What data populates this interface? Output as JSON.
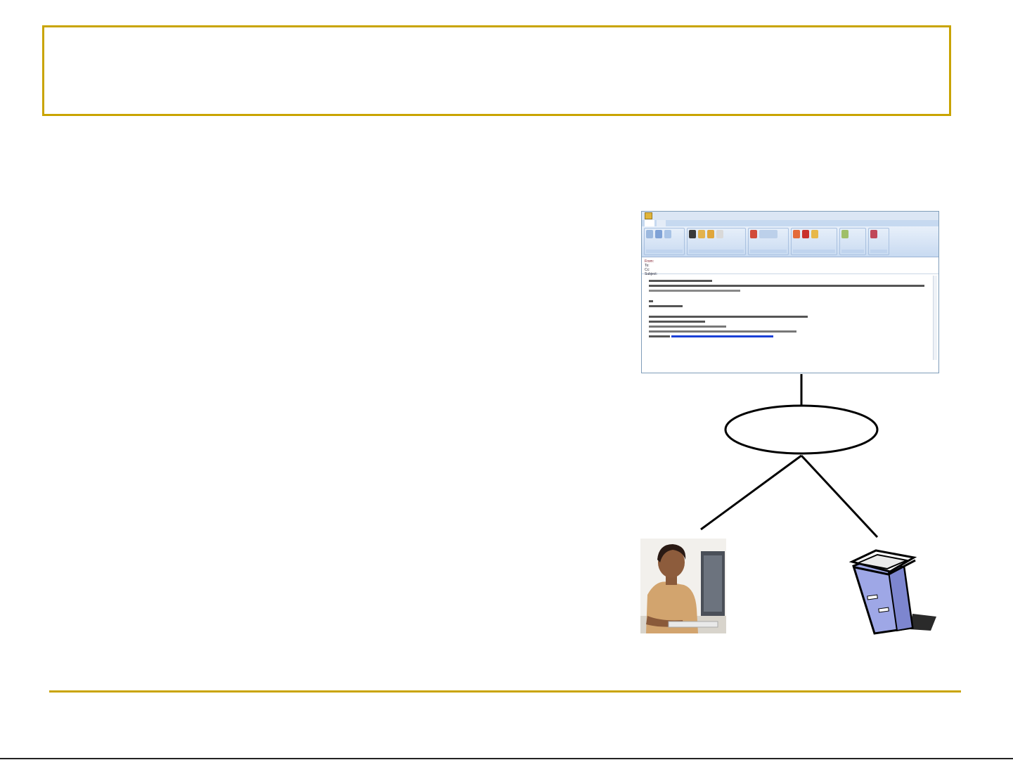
{
  "slide": {
    "title": "",
    "colors": {
      "accent": "#c9a400",
      "line": "#000000"
    }
  },
  "mail_window": {
    "icon": "outlook-envelope-icon",
    "window_title": "",
    "tabs": [
      "",
      ""
    ],
    "ribbon_groups": [
      "",
      "",
      "",
      "",
      "",
      ""
    ],
    "headers": {
      "from_label": "From:",
      "to_label": "To:",
      "cc_label": "Cc:",
      "subject_label": "Subject:",
      "from_value": "",
      "to_value": "",
      "subject_value": "",
      "sent_value": ""
    },
    "body_lines": [
      "",
      "",
      "",
      "",
      "",
      "",
      "",
      "",
      ""
    ]
  },
  "ellipse": {
    "label": ""
  },
  "client": {
    "icon": "woman-at-computer-icon"
  },
  "server": {
    "icon": "server-tower-icon"
  }
}
